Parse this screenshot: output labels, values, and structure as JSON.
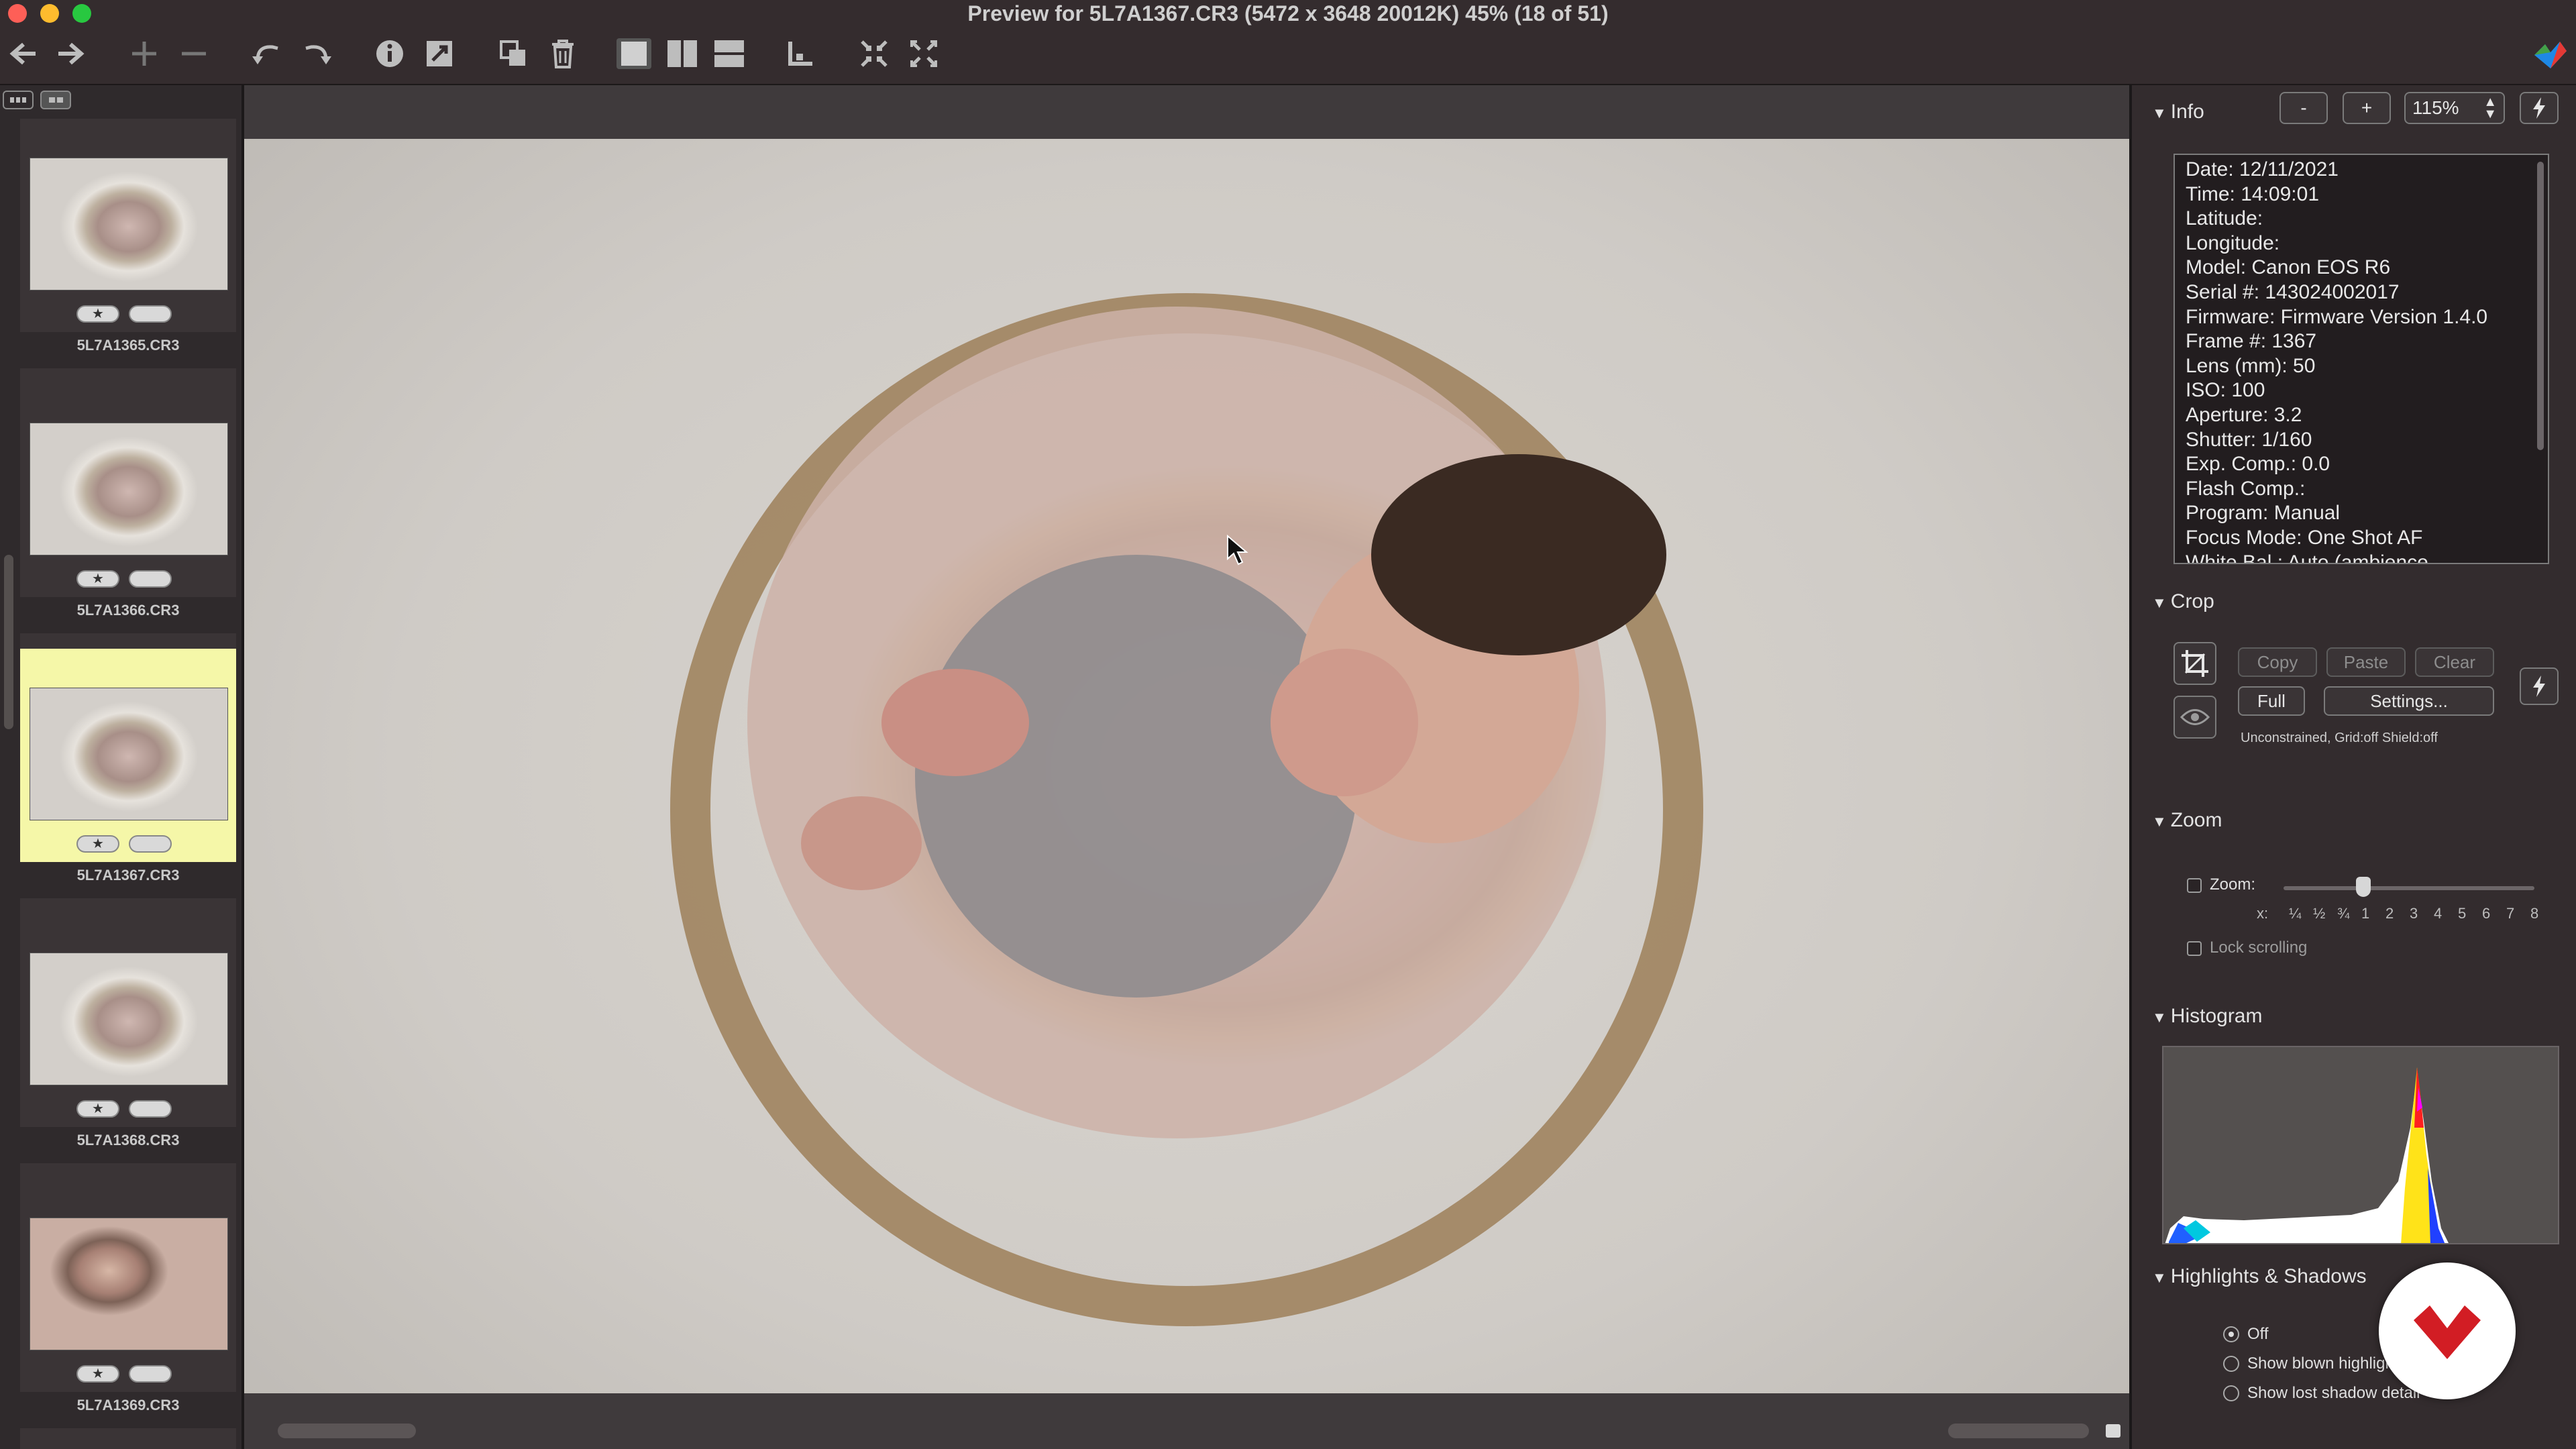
{
  "window": {
    "title": "Preview for 5L7A1367.CR3 (5472 x 3648 20012K) 45% (18 of 51)",
    "traffic_colors": [
      "#fe5f57",
      "#febc2e",
      "#28c840"
    ]
  },
  "toolbar": {
    "icons": [
      "back-arrow-icon",
      "forward-arrow-icon",
      "add-icon",
      "remove-icon",
      "rotate-left-icon",
      "rotate-right-icon",
      "info-icon",
      "edit-image-icon",
      "copy-icon",
      "trash-icon",
      "single-view-icon",
      "side-by-side-icon",
      "stacked-view-icon",
      "align-icon",
      "fit-icon",
      "fullscreen-icon"
    ]
  },
  "filmstrip": {
    "selected_color": "#f5f7a8",
    "items": [
      {
        "name": "5L7A1365.CR3",
        "selected": false
      },
      {
        "name": "5L7A1366.CR3",
        "selected": false
      },
      {
        "name": "5L7A1367.CR3",
        "selected": true
      },
      {
        "name": "5L7A1368.CR3",
        "selected": false
      },
      {
        "name": "5L7A1369.CR3",
        "selected": false
      }
    ],
    "star_glyph": "★"
  },
  "inspector": {
    "info": {
      "title": "Info",
      "minus_label": "-",
      "plus_label": "+",
      "zoom_value": "115%",
      "lines": [
        "Date: 12/11/2021",
        "Time: 14:09:01",
        "Latitude:",
        "Longitude:",
        "Model: Canon EOS R6",
        "Serial #: 143024002017",
        "Firmware: Firmware Version 1.4.0",
        "Frame #: 1367",
        "Lens (mm): 50",
        "ISO: 100",
        "Aperture: 3.2",
        "Shutter: 1/160",
        "Exp. Comp.: 0.0",
        "Flash Comp.:",
        "Program: Manual",
        "Focus Mode: One Shot AF",
        "White Bal.: Auto (ambience"
      ]
    },
    "crop": {
      "title": "Crop",
      "copy_label": "Copy",
      "paste_label": "Paste",
      "clear_label": "Clear",
      "full_label": "Full",
      "settings_label": "Settings...",
      "status": "Unconstrained, Grid:off Shield:off"
    },
    "zoom": {
      "title": "Zoom",
      "zoom_label": "Zoom:",
      "scale_prefix": "x:",
      "scale_ticks": [
        "¼",
        "½",
        "¾",
        "1",
        "2",
        "3",
        "4",
        "5",
        "6",
        "7",
        "8"
      ],
      "slider_value": "¾",
      "lock_label": "Lock scrolling"
    },
    "histogram": {
      "title": "Histogram"
    },
    "highlights": {
      "title": "Highlights & Shadows",
      "options": [
        "Off",
        "Show blown highlights",
        "Show lost shadow detail"
      ],
      "selected": "Off"
    }
  },
  "overlay_badge": {
    "color": "#d21d24"
  }
}
